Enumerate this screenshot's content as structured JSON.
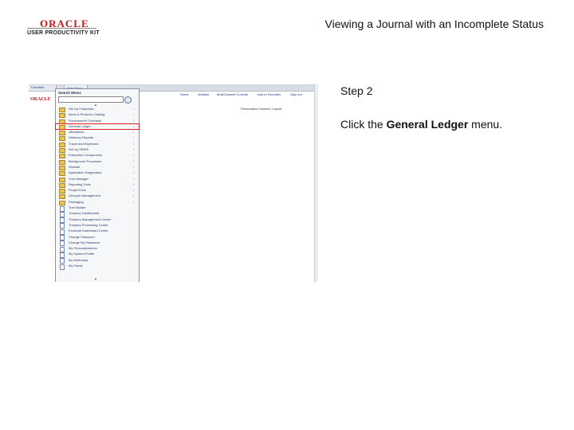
{
  "branding": {
    "logo_top": "ORACLE",
    "logo_bottom": "USER PRODUCTIVITY KIT"
  },
  "slide_title": "Viewing a Journal with an Incomplete Status",
  "step": {
    "label": "Step 2",
    "instruction_prefix": "Click the ",
    "instruction_target": "General Ledger",
    "instruction_suffix": " menu."
  },
  "screenshot": {
    "tabs": [
      "Favorites",
      "Main Menu"
    ],
    "top_links": [
      "Home",
      "Worklist",
      "MultiChannel Console",
      "Add to Favorites",
      "Sign out"
    ],
    "mini_logo": "ORACLE",
    "personalize": "Personalize Content | Layout",
    "menu": {
      "title": "Search Menu:",
      "up_arrow": "▲",
      "down_arrow": "▼",
      "items": [
        {
          "label": "Set Up Financials",
          "type": "folder",
          "submenu": true
        },
        {
          "label": "Items & Products Catalog",
          "type": "folder",
          "submenu": true
        },
        {
          "label": "Procurement Contracts",
          "type": "folder",
          "submenu": true
        },
        {
          "label": "General Ledger",
          "type": "folder",
          "submenu": true
        },
        {
          "label": "Allocations",
          "type": "folder",
          "submenu": true
        },
        {
          "label": "Statutory Reports",
          "type": "folder",
          "submenu": true
        },
        {
          "label": "Travel and Expenses",
          "type": "folder",
          "submenu": true
        },
        {
          "label": "Set Up HRMS",
          "type": "folder",
          "submenu": true
        },
        {
          "label": "Enterprise Components",
          "type": "folder",
          "submenu": true
        },
        {
          "label": "Background Processes",
          "type": "folder",
          "submenu": true
        },
        {
          "label": "Worklist",
          "type": "folder",
          "submenu": true
        },
        {
          "label": "Application Diagnostics",
          "type": "folder",
          "submenu": true
        },
        {
          "label": "Tree Manager",
          "type": "folder",
          "submenu": true
        },
        {
          "label": "Reporting Tools",
          "type": "folder",
          "submenu": true
        },
        {
          "label": "PeopleTools",
          "type": "folder",
          "submenu": true
        },
        {
          "label": "Lifecycle Management",
          "type": "folder",
          "submenu": true
        },
        {
          "label": "Packaging",
          "type": "folder",
          "submenu": true
        },
        {
          "label": "Tree Builder",
          "type": "doc",
          "submenu": false
        },
        {
          "label": "Treasury Dashboards",
          "type": "doc",
          "submenu": false
        },
        {
          "label": "Treasury Management Center",
          "type": "doc",
          "submenu": false
        },
        {
          "label": "Treasury Processing Center",
          "type": "doc",
          "submenu": false
        },
        {
          "label": "Financial Dashboard Center",
          "type": "doc",
          "submenu": false
        },
        {
          "label": "Change Password",
          "type": "doc",
          "submenu": false
        },
        {
          "label": "Change My Password",
          "type": "doc",
          "submenu": false
        },
        {
          "label": "My Personalizations",
          "type": "doc",
          "submenu": false
        },
        {
          "label": "My System Profile",
          "type": "doc",
          "submenu": false
        },
        {
          "label": "My Dictionary",
          "type": "doc",
          "submenu": false
        },
        {
          "label": "My Feeds",
          "type": "doc",
          "submenu": false
        }
      ]
    }
  },
  "colors": {
    "highlight": "#e31b23",
    "brand_red": "#c4161c"
  }
}
